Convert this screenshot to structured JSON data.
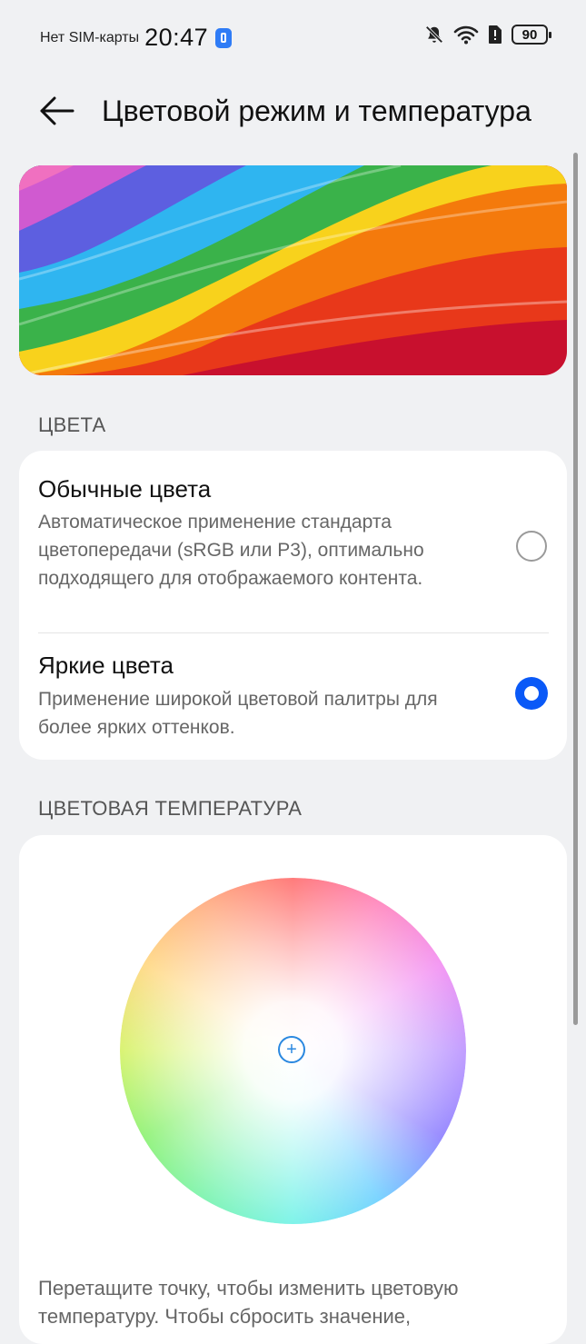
{
  "status_bar": {
    "carrier": "Нет SIM-карты",
    "time": "20:47",
    "battery_level": "90",
    "icons": [
      "notification-badge-icon",
      "mute-bell-icon",
      "wifi-icon",
      "sim-icon",
      "battery-icon"
    ]
  },
  "header": {
    "back_icon": "back-arrow-icon",
    "title": "Цветовой режим и температура"
  },
  "colors_section": {
    "title": "ЦВЕТА",
    "options": [
      {
        "title": "Обычные цвета",
        "description": "Автоматическое применение стандарта цветопередачи (sRGB или P3), оптимально подходящего для отображаемого контента.",
        "selected": false
      },
      {
        "title": "Яркие цвета",
        "description": "Применение широкой цветовой палитры для более ярких оттенков.",
        "selected": true
      }
    ]
  },
  "temperature_section": {
    "title": "ЦВЕТОВАЯ ТЕМПЕРАТУРА",
    "handle_icon": "crosshair-plus-icon",
    "hint": "Перетащите точку, чтобы изменить цветовую температуру. Чтобы сбросить значение,"
  },
  "colors": {
    "accent": "#0a59f7",
    "background": "#f0f1f3",
    "card": "#ffffff"
  }
}
